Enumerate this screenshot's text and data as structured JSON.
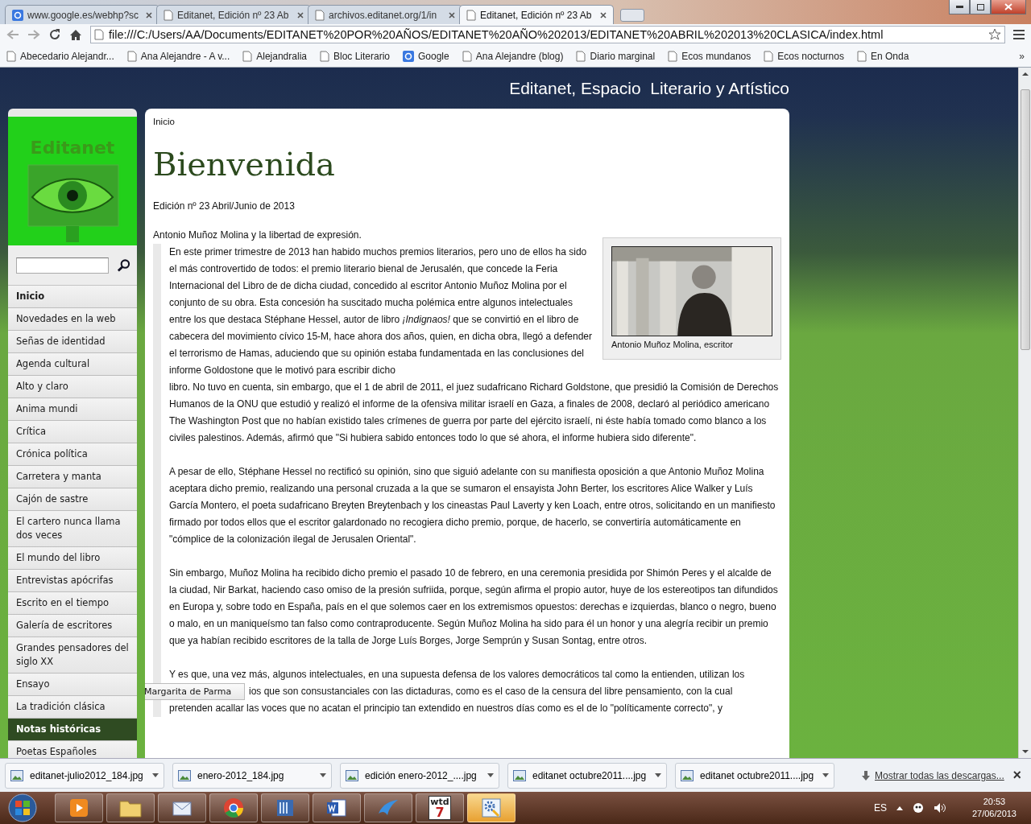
{
  "browser": {
    "tabs": [
      {
        "title": "www.google.es/webhp?sc",
        "kind": "google",
        "selected": false
      },
      {
        "title": "Editanet, Edición nº 23 Ab",
        "kind": "page",
        "selected": false
      },
      {
        "title": "archivos.editanet.org/1/in",
        "kind": "page",
        "selected": false
      },
      {
        "title": "Editanet, Edición nº 23 Ab",
        "kind": "page",
        "selected": true
      }
    ],
    "address": "file:///C:/Users/AA/Documents/EDITANET%20POR%20AÑOS/EDITANET%20AÑO%202013/EDITANET%20ABRIL%202013%20CLASICA/index.html",
    "bookmarks": [
      {
        "label": "Abecedario Alejandr...",
        "kind": "page"
      },
      {
        "label": "Ana Alejandre - A v...",
        "kind": "page"
      },
      {
        "label": "Alejandralia",
        "kind": "page"
      },
      {
        "label": "Bloc Literario",
        "kind": "page"
      },
      {
        "label": "Google",
        "kind": "google"
      },
      {
        "label": "Ana Alejandre (blog)",
        "kind": "page"
      },
      {
        "label": "Diario marginal",
        "kind": "page"
      },
      {
        "label": "Ecos mundanos",
        "kind": "page"
      },
      {
        "label": "Ecos nocturnos",
        "kind": "page"
      },
      {
        "label": "En Onda",
        "kind": "page"
      }
    ],
    "bookmarks_more": "»"
  },
  "site": {
    "header": "Editanet, Espacio  Literario y Artístico",
    "logo_text": "Editanet",
    "nav": [
      {
        "label": "Inicio",
        "current": true,
        "selected": false
      },
      {
        "label": "Novedades en la web",
        "current": false,
        "selected": false
      },
      {
        "label": "Señas de identidad",
        "current": false,
        "selected": false
      },
      {
        "label": "Agenda cultural",
        "current": false,
        "selected": false
      },
      {
        "label": "Alto y claro",
        "current": false,
        "selected": false
      },
      {
        "label": "Anima mundi",
        "current": false,
        "selected": false
      },
      {
        "label": "Crítica",
        "current": false,
        "selected": false
      },
      {
        "label": "Crónica política",
        "current": false,
        "selected": false
      },
      {
        "label": "Carretera y manta",
        "current": false,
        "selected": false
      },
      {
        "label": "Cajón de sastre",
        "current": false,
        "selected": false
      },
      {
        "label": "El cartero nunca llama dos veces",
        "current": false,
        "selected": false
      },
      {
        "label": "El mundo del libro",
        "current": false,
        "selected": false
      },
      {
        "label": "Entrevistas apócrifas",
        "current": false,
        "selected": false
      },
      {
        "label": "Escrito en el tiempo",
        "current": false,
        "selected": false
      },
      {
        "label": "Galería de escritores",
        "current": false,
        "selected": false
      },
      {
        "label": "Grandes pensadores del siglo XX",
        "current": false,
        "selected": false
      },
      {
        "label": "Ensayo",
        "current": false,
        "selected": false
      },
      {
        "label": "La tradición clásica",
        "current": false,
        "selected": false
      },
      {
        "label": "Notas históricas",
        "current": false,
        "selected": true
      },
      {
        "label": "Poetas Españoles",
        "current": false,
        "selected": false
      }
    ],
    "submenu_tooltip": "Margarita de Parma",
    "breadcrumb": "Inicio",
    "title": "Bienvenida",
    "edition": "Edición nº 23 Abril/Junio de 2013",
    "article_title": "Antonio Muñoz Molina y la libertad de expresión.",
    "figure_caption": "Antonio Muñoz Molina, escritor",
    "lead_text": "En este primer trimestre de 2013 han habido muchos premios literarios, pero uno de ellos ha sido el más controvertido de todos: el premio literario bienal de Jerusalén, que concede la Feria Internacional del Libro de de dicha ciudad, concedido al escritor Antonio Muñoz Molina por el conjunto de su obra. Esta concesión ha suscitado mucha polémica entre algunos intelectuales entre los que destaca Stéphane Hessel, autor de libro *¡Indignaos!* que se convirtió en el libro de cabecera del movimiento cívico 15-M, hace ahora dos años, quien, en dicha obra, llegó a defender el terrorismo de Hamas, aduciendo que su opinión estaba fundamentada en las conclusiones del informe Goldostone que le motivó para escribir dicho",
    "paragraphs": [
      "libro. No tuvo en cuenta, sin embargo, que el 1 de abril de 2011, el juez sudafricano Richard Goldstone, que presidió la Comisión de Derechos Humanos de la ONU que estudió y realizó el informe de la ofensiva militar israelí en Gaza, a finales de 2008, declaró al periódico americano The Washington Post que no habían existido tales crímenes de guerra por parte del ejército israelí, ni éste había tomado como blanco a los civiles palestinos. Además, afirmó que \"Si hubiera sabido entonces todo lo que sé ahora, el informe hubiera sido diferente\".",
      "A pesar de ello, Stéphane Hessel no rectificó su opinión, sino que siguió adelante con su manifiesta oposición a que Antonio Muñoz Molina aceptara dicho premio, realizando una personal cruzada a la que se sumaron el ensayista John Berter, los escritores Alice Walker y Luís García Montero, el poeta sudafricano Breyten Breytenbach y los cineastas Paul Laverty y ken Loach, entre otros, solicitando en un manifiesto firmado por todos ellos que el escritor galardonado no recogiera dicho premio, porque, de hacerlo, se convertiría automáticamente en \"cómplice de la colonización ilegal de Jerusalen Oriental\".",
      "Sin embargo, Muñoz Molina ha recibido dicho premio el pasado 10 de febrero, en una ceremonia presidida por Shimón Peres y el alcalde de la ciudad, Nir Barkat, haciendo caso omiso de la presión sufriida, porque, según afirma el propio autor, huye de los estereotipos tan difundidos en Europa y, sobre todo en España, país en el que solemos caer en los extremismos opuestos: derechas e izquierdas, blanco o negro, bueno o malo, en un maniqueísmo tan falso como contraproducente. Según Muñoz Molina ha sido para él un honor y una alegría recibir un premio que ya habían recibido escritores de la talla de Jorge Luís Borges, Jorge Semprún y Susan Sontag, entre otros."
    ],
    "last_paragraph_lines": [
      "Y es que, una vez más, algunos intelectuales, en una supuesta defensa de los valores democráticos tal como la entienden, utilizan los",
      "ios que son consustanciales con las dictaduras, como es el caso de la censura del libre pensamiento, con la cual",
      "pretenden acallar las voces que no acatan el principio tan extendido en nuestros días como es el de lo \"políticamente correcto\", y"
    ]
  },
  "downloads": {
    "items": [
      "editanet-julio2012_184.jpg",
      "enero-2012_184.jpg",
      "edición enero-2012_....jpg",
      "editanet octubre2011....jpg",
      "editanet octubre2011....jpg"
    ],
    "show_all": "Mostrar todas las descargas...",
    "close": "×"
  },
  "taskbar": {
    "apps": [
      {
        "kind": "media",
        "selected": false
      },
      {
        "kind": "folder",
        "selected": false
      },
      {
        "kind": "mail",
        "selected": false
      },
      {
        "kind": "chrome",
        "selected": false
      },
      {
        "kind": "book",
        "selected": false
      },
      {
        "kind": "word",
        "selected": false
      },
      {
        "kind": "bird",
        "selected": false
      },
      {
        "kind": "wtd",
        "selected": false
      },
      {
        "kind": "settings",
        "selected": true
      }
    ],
    "wtd_label": "wtd",
    "wtd_num": "7",
    "language": "ES",
    "time": "20:53",
    "date": "27/06/2013"
  }
}
